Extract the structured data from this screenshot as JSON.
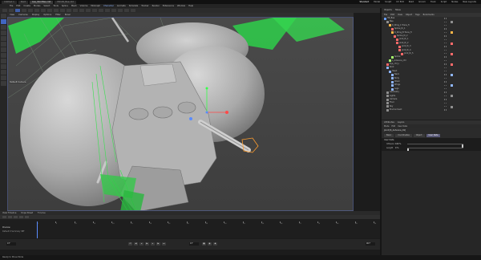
{
  "titlebar": {
    "tabs": [
      "Untitled 1",
      "Start",
      "bee_WorkBee.c4d",
      "HR109_Bee.c4d"
    ],
    "active_tab": 2,
    "layouts": [
      "Standard",
      "Model",
      "Sculpt",
      "UV Edit",
      "Paint",
      "Groom",
      "Track",
      "Script",
      "Nodes",
      "New Layouts"
    ]
  },
  "menubar": {
    "items": [
      "File",
      "Edit",
      "Create",
      "Modes",
      "Select",
      "Tools",
      "Spline",
      "Mesh",
      "Volume",
      "MoGraph",
      "Character",
      "Animate",
      "Simulate",
      "Tracker",
      "Render",
      "Extensions",
      "Window",
      "Help"
    ],
    "highlight": "Character"
  },
  "viewport": {
    "menu": [
      "View",
      "Cameras",
      "Display",
      "Options",
      "Filter",
      "Panel"
    ],
    "name": "Perspective",
    "camera_label": "Default Camera",
    "grid_spacing": "Grid Spacing : 1 cm"
  },
  "object_manager": {
    "header": [
      "Objects",
      "Takes"
    ],
    "tabs": [
      "File",
      "Edit",
      "View",
      "Object",
      "Tags",
      "Bookmarks"
    ],
    "rows": [
      {
        "name": "HR_Bee",
        "indent": 0,
        "color": "#6aa0ff"
      },
      {
        "name": "Bee",
        "indent": 3,
        "color": "#8f8f8f"
      },
      {
        "name": "R_Wing_C Trans_fl",
        "indent": 6,
        "color": "#ffb648"
      },
      {
        "name": "Spline_IK_1",
        "indent": 9,
        "color": "#ff6a6a"
      },
      {
        "name": "R_Wing_B Trans_fl",
        "indent": 9,
        "color": "#ffb648"
      },
      {
        "name": "Spline_IK_2",
        "indent": 12,
        "color": "#ff6a6a"
      },
      {
        "name": "Joint_IK_1",
        "indent": 15,
        "color": "#ff6a6a"
      },
      {
        "name": "Joint_IK_2",
        "indent": 15,
        "color": "#ff6a6a"
      },
      {
        "name": "Joint_IK_3",
        "indent": 18,
        "color": "#ff6a6a"
      },
      {
        "name": "Joint_IK_4",
        "indent": 18,
        "color": "#ff6a6a"
      },
      {
        "name": "Joint_IK_5",
        "indent": 21,
        "color": "#ff6a6a"
      },
      {
        "name": "Spline",
        "indent": 9,
        "color": "#a7ff6a"
      },
      {
        "name": "L_Antenna_ctrl",
        "indent": 6,
        "color": "#a7ff6a"
      },
      {
        "name": "Eye_ctrl_L",
        "indent": 3,
        "color": "#ff6a6a"
      },
      {
        "name": "Root",
        "indent": 3,
        "color": "#8fb6ff"
      },
      {
        "name": "Head",
        "indent": 6,
        "color": "#8fb6ff"
      },
      {
        "name": "Neck",
        "indent": 9,
        "color": "#8fb6ff"
      },
      {
        "name": "Body",
        "indent": 9,
        "color": "#8fb6ff"
      },
      {
        "name": "Waist",
        "indent": 9,
        "color": "#8fb6ff"
      },
      {
        "name": "Wings",
        "indent": 9,
        "color": "#8fb6ff"
      },
      {
        "name": "Legs",
        "indent": 9,
        "color": "#8fb6ff"
      },
      {
        "name": "Geometry",
        "indent": 3,
        "color": "#8f8f8f"
      },
      {
        "name": "Lights",
        "indent": 3,
        "color": "#8f8f8f"
      },
      {
        "name": "Camera",
        "indent": 3,
        "color": "#8f8f8f"
      },
      {
        "name": "Floor",
        "indent": 3,
        "color": "#8f8f8f"
      },
      {
        "name": "Sky",
        "indent": 3,
        "color": "#8f8f8f"
      },
      {
        "name": "Environment",
        "indent": 3,
        "color": "#8f8f8f"
      }
    ]
  },
  "attributes": {
    "header": [
      "Attributes",
      "Layers"
    ],
    "mode_items": [
      "Mode",
      "Edit",
      "User Data"
    ],
    "title": "Joint [R_Antenna_01]",
    "tabs": [
      "Basic",
      "Coordinates",
      "Object",
      "User Data"
    ],
    "active_tab": 3,
    "section": "User Data",
    "fields": [
      {
        "label": "Influence",
        "value": "100 %",
        "fraction": 1.0
      },
      {
        "label": "Length",
        "value": "0 %",
        "fraction": 0.0
      }
    ]
  },
  "timeline": {
    "header": [
      "View Timeline",
      "Dope Sheet",
      "F-Curve"
    ],
    "track_label": "Preview",
    "track_sub": "Default 0 Summary 3BF",
    "ruler_labels": [
      "0",
      "5",
      "10",
      "15",
      "20",
      "25",
      "30",
      "35",
      "40",
      "45",
      "50",
      "55",
      "60",
      "65",
      "70",
      "75",
      "80",
      "85",
      "90"
    ],
    "ruler2_labels": [
      "0",
      "5",
      "10",
      "15",
      "20",
      "25",
      "30",
      "35",
      "40",
      "45",
      "50",
      "55",
      "60",
      "65",
      "70",
      "75",
      "80",
      "85",
      "90"
    ],
    "current_frame": "0 F",
    "start_frame": "0 F",
    "end_frame": "90 F"
  },
  "statusbar": {
    "text": "Ready to Move Mode"
  }
}
